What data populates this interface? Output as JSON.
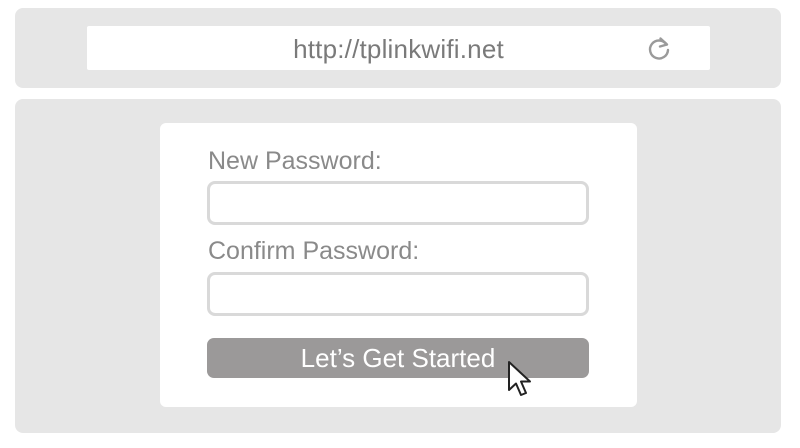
{
  "browser": {
    "url": "http://tplinkwifi.net",
    "reload_icon": "reload-icon"
  },
  "form": {
    "new_password_label": "New Password:",
    "new_password_value": "",
    "confirm_password_label": "Confirm Password:",
    "confirm_password_value": "",
    "submit_label": "Let’s Get Started"
  },
  "cursor": {
    "icon": "mouse-pointer-icon"
  },
  "colors": {
    "panel_background": "#e6e6e6",
    "card_background": "#ffffff",
    "text_gray": "#8a8a8a",
    "button_gray": "#9b9999",
    "input_border": "#d9d9d9"
  }
}
